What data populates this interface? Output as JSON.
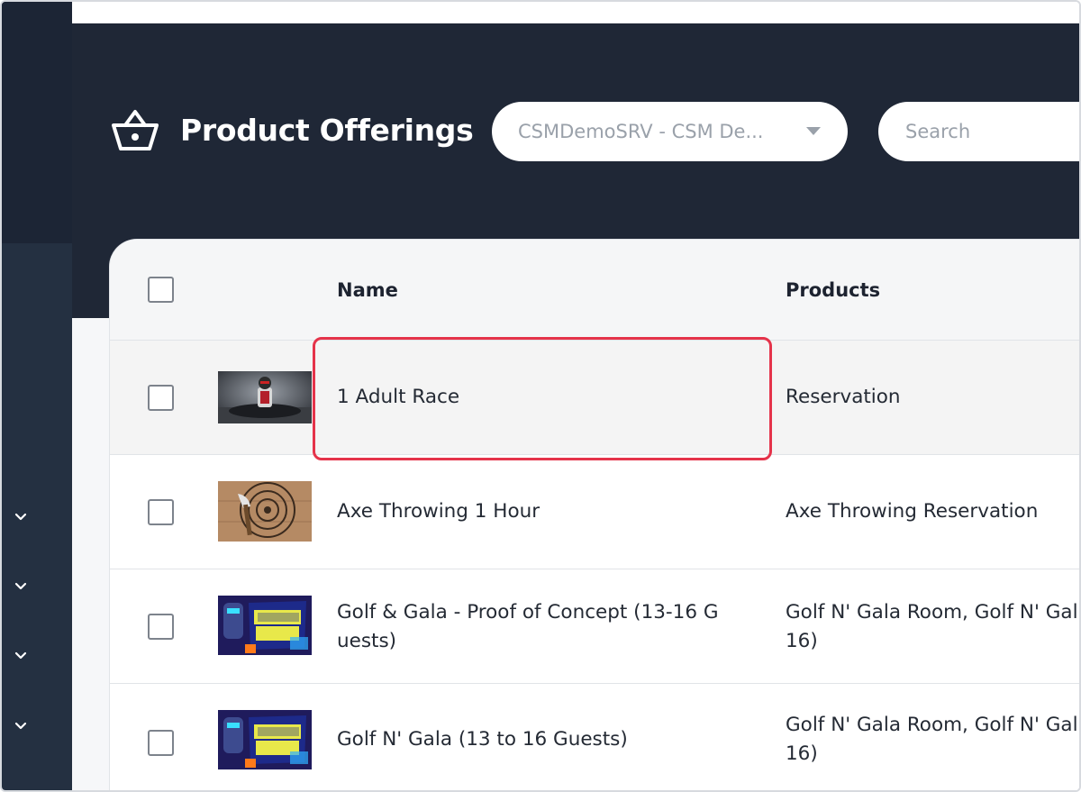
{
  "header": {
    "title": "Product Offerings",
    "location_select": {
      "value": "CSMDemoSRV - CSM De..."
    },
    "search": {
      "placeholder": "Search"
    }
  },
  "table": {
    "columns": {
      "name": "Name",
      "products": "Products"
    },
    "rows": [
      {
        "name": "1 Adult Race",
        "products": "Reservation",
        "thumb": "go-kart-racer"
      },
      {
        "name": "Axe Throwing 1 Hour",
        "products": "Axe Throwing Reservation",
        "thumb": "axe-target"
      },
      {
        "name_line1": "Golf & Gala - Proof of Concept (13-16 G",
        "name_line2": "uests)",
        "products_line1": "Golf N' Gala Room, Golf N' Gal",
        "products_line2": "16)",
        "thumb": "golf-n-gala-logo"
      },
      {
        "name": "Golf N' Gala (13 to 16 Guests)",
        "products_line1": "Golf N' Gala Room, Golf N' Gal",
        "products_line2": "16)",
        "thumb": "golf-n-gala-logo"
      }
    ]
  },
  "icons": {
    "title_icon": "basket-icon",
    "sidebar_toggles": "chevron-down-icon",
    "dropdown_caret": "caret-down-icon"
  },
  "colors": {
    "sidebar": "#243041",
    "header": "#1f2736",
    "highlight": "#e5334a"
  }
}
